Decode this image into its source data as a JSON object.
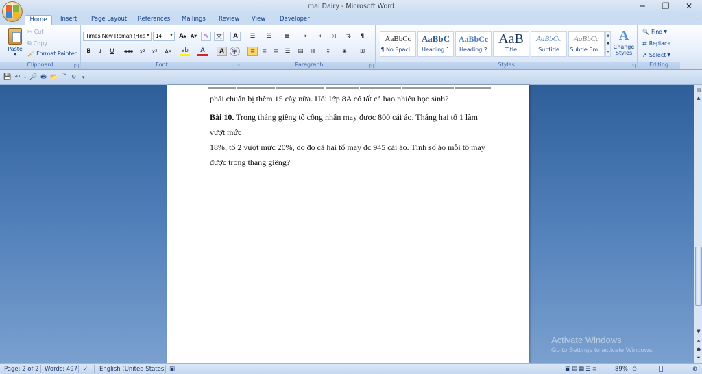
{
  "window": {
    "title": "mal Dairy - Microsoft Word",
    "controls": {
      "minimize": "─",
      "restore": "❐",
      "close": "✕"
    }
  },
  "tabs": [
    "Home",
    "Insert",
    "Page Layout",
    "References",
    "Mailings",
    "Review",
    "View",
    "Developer"
  ],
  "active_tab": "Home",
  "ribbon": {
    "clipboard": {
      "label": "Clipboard",
      "paste": "Paste",
      "cut": "Cut",
      "copy": "Copy",
      "format_painter": "Format Painter"
    },
    "font": {
      "label": "Font",
      "font_name": "Times New Roman (Hea",
      "font_size": "14"
    },
    "paragraph": {
      "label": "Paragraph"
    },
    "styles": {
      "label": "Styles",
      "items": [
        {
          "preview": "AaBbCc",
          "name": "¶ No Spaci..."
        },
        {
          "preview": "AaBbC",
          "name": "Heading 1"
        },
        {
          "preview": "AaBbCc",
          "name": "Heading 2"
        },
        {
          "preview": "AaB",
          "name": "Title"
        },
        {
          "preview": "AaBbCc",
          "name": "Subtitle"
        },
        {
          "preview": "AaBbCc",
          "name": "Subtle Em..."
        }
      ],
      "change_styles": "Change Styles"
    },
    "editing": {
      "label": "Editing",
      "find": "Find",
      "replace": "Replace",
      "select": "Select"
    }
  },
  "document": {
    "line_partial": "phải chuẩn bị thêm 15 cây nữa. Hỏi lớp 8A có tất cả bao nhiêu học sinh?",
    "problem_label": "Bài 10.",
    "problem_line1": " Trong tháng giêng tổ công nhân may được 800 cái áo. Tháng hai tổ 1 làm",
    "problem_line2": "vượt mức",
    "problem_line3": "18%, tổ 2 vượt mức 20%, do đó cả hai tổ may đc 945 cái áo. Tính số áo mỗi tổ may",
    "problem_line4": "được trong tháng giêng?"
  },
  "watermark": {
    "line1": "Activate Windows",
    "line2": "Go to Settings to activate Windows."
  },
  "status": {
    "page": "Page: 2 of 2",
    "words": "Words: 497",
    "language": "English (United States)",
    "zoom": "89%"
  },
  "colors": {
    "ribbon_text": "#15428b",
    "workspace": "#5583bc"
  }
}
